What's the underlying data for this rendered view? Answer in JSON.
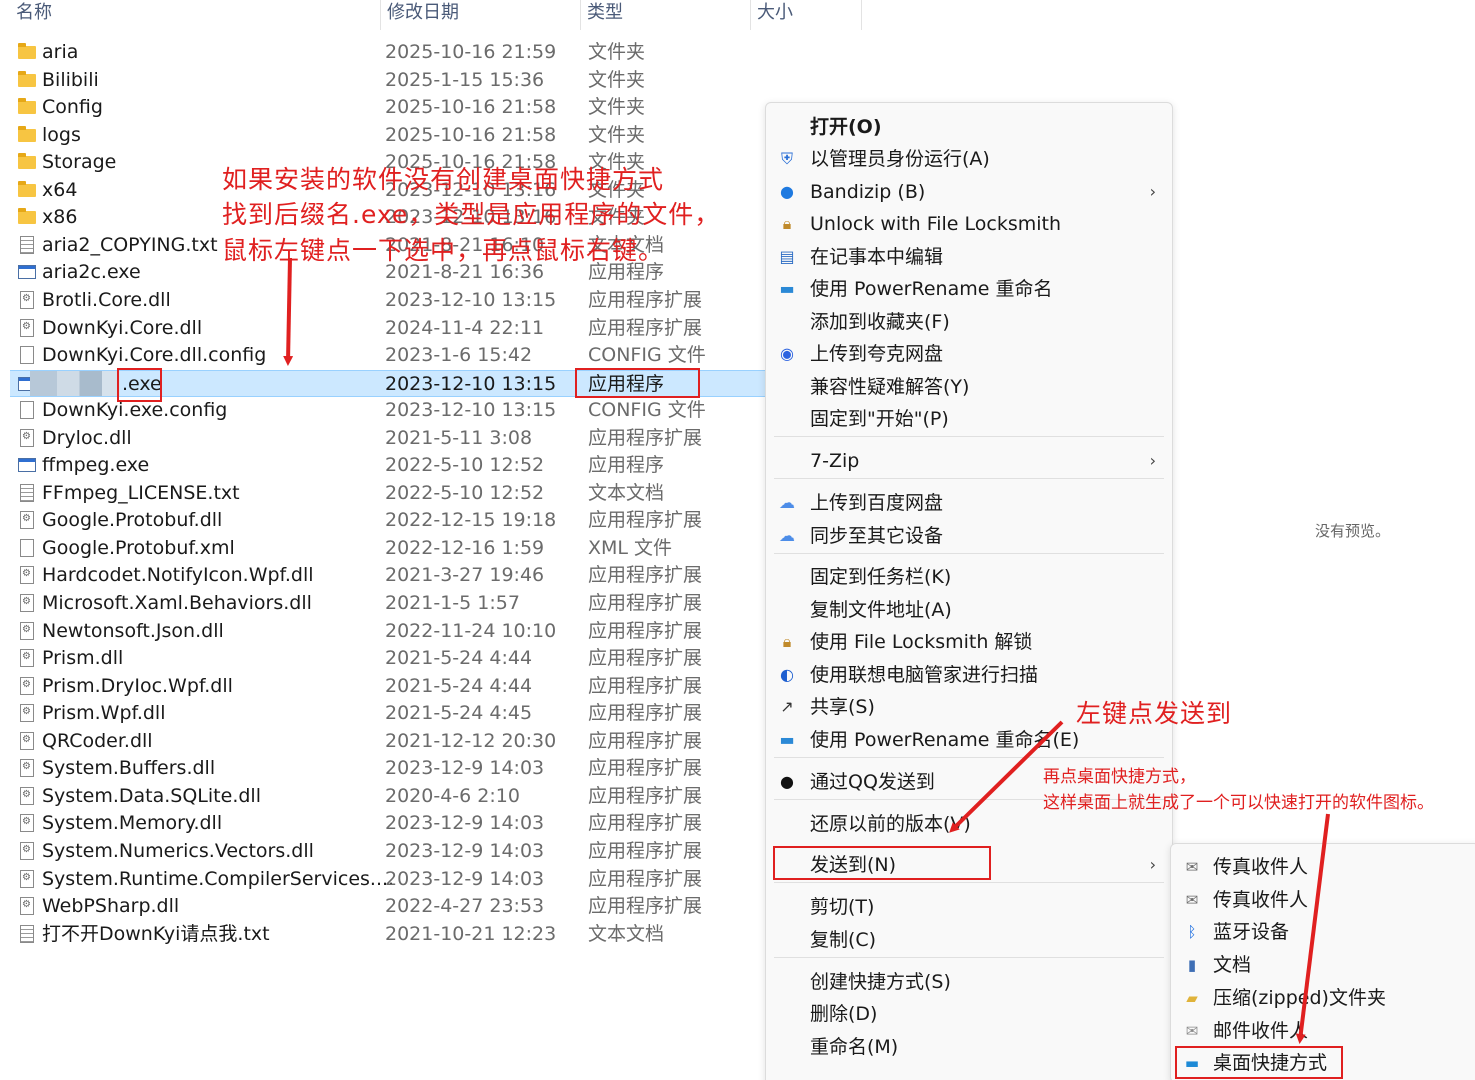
{
  "columns": {
    "name": "名称",
    "modified": "修改日期",
    "type": "类型",
    "size": "大小"
  },
  "files": [
    {
      "name": "aria",
      "date": "2025-10-16 21:59",
      "type": "文件夹",
      "icon": "folder"
    },
    {
      "name": "Bilibili",
      "date": "2025-1-15 15:36",
      "type": "文件夹",
      "icon": "folder"
    },
    {
      "name": "Config",
      "date": "2025-10-16 21:58",
      "type": "文件夹",
      "icon": "folder"
    },
    {
      "name": "logs",
      "date": "2025-10-16 21:58",
      "type": "文件夹",
      "icon": "folder"
    },
    {
      "name": "Storage",
      "date": "2025-10-16 21:58",
      "type": "文件夹",
      "icon": "folder"
    },
    {
      "name": "x64",
      "date": "2023-12-10 13:16",
      "type": "文件夹",
      "icon": "folder"
    },
    {
      "name": "x86",
      "date": "2023-12-10 13:16",
      "type": "文件夹",
      "icon": "folder"
    },
    {
      "name": "aria2_COPYING.txt",
      "date": "2021-8-21 16:10",
      "type": "文本文档",
      "icon": "txt"
    },
    {
      "name": "aria2c.exe",
      "date": "2021-8-21 16:36",
      "type": "应用程序",
      "icon": "exe"
    },
    {
      "name": "Brotli.Core.dll",
      "date": "2023-12-10 13:15",
      "type": "应用程序扩展",
      "icon": "dll"
    },
    {
      "name": "DownKyi.Core.dll",
      "date": "2024-11-4 22:11",
      "type": "应用程序扩展",
      "icon": "dll"
    },
    {
      "name": "DownKyi.Core.dll.config",
      "date": "2023-1-6 15:42",
      "type": "CONFIG 文件",
      "icon": "file"
    },
    {
      "name": ".exe",
      "date": "2023-12-10 13:15",
      "type": "应用程序",
      "icon": "exe",
      "selected": true
    },
    {
      "name": "DownKyi.exe.config",
      "date": "2023-12-10 13:15",
      "type": "CONFIG 文件",
      "icon": "file"
    },
    {
      "name": "Dryloc.dll",
      "date": "2021-5-11 3:08",
      "type": "应用程序扩展",
      "icon": "dll"
    },
    {
      "name": "ffmpeg.exe",
      "date": "2022-5-10 12:52",
      "type": "应用程序",
      "icon": "exe"
    },
    {
      "name": "FFmpeg_LICENSE.txt",
      "date": "2022-5-10 12:52",
      "type": "文本文档",
      "icon": "txt"
    },
    {
      "name": "Google.Protobuf.dll",
      "date": "2022-12-15 19:18",
      "type": "应用程序扩展",
      "icon": "dll"
    },
    {
      "name": "Google.Protobuf.xml",
      "date": "2022-12-16 1:59",
      "type": "XML 文件",
      "icon": "file"
    },
    {
      "name": "Hardcodet.NotifyIcon.Wpf.dll",
      "date": "2021-3-27 19:46",
      "type": "应用程序扩展",
      "icon": "dll"
    },
    {
      "name": "Microsoft.Xaml.Behaviors.dll",
      "date": "2021-1-5 1:57",
      "type": "应用程序扩展",
      "icon": "dll"
    },
    {
      "name": "Newtonsoft.Json.dll",
      "date": "2022-11-24 10:10",
      "type": "应用程序扩展",
      "icon": "dll"
    },
    {
      "name": "Prism.dll",
      "date": "2021-5-24 4:44",
      "type": "应用程序扩展",
      "icon": "dll"
    },
    {
      "name": "Prism.DryIoc.Wpf.dll",
      "date": "2021-5-24 4:44",
      "type": "应用程序扩展",
      "icon": "dll"
    },
    {
      "name": "Prism.Wpf.dll",
      "date": "2021-5-24 4:45",
      "type": "应用程序扩展",
      "icon": "dll"
    },
    {
      "name": "QRCoder.dll",
      "date": "2021-12-12 20:30",
      "type": "应用程序扩展",
      "icon": "dll"
    },
    {
      "name": "System.Buffers.dll",
      "date": "2023-12-9 14:03",
      "type": "应用程序扩展",
      "icon": "dll"
    },
    {
      "name": "System.Data.SQLite.dll",
      "date": "2020-4-6 2:10",
      "type": "应用程序扩展",
      "icon": "dll"
    },
    {
      "name": "System.Memory.dll",
      "date": "2023-12-9 14:03",
      "type": "应用程序扩展",
      "icon": "dll"
    },
    {
      "name": "System.Numerics.Vectors.dll",
      "date": "2023-12-9 14:03",
      "type": "应用程序扩展",
      "icon": "dll"
    },
    {
      "name": "System.Runtime.CompilerServices....",
      "date": "2023-12-9 14:03",
      "type": "应用程序扩展",
      "icon": "dll"
    },
    {
      "name": "WebPSharp.dll",
      "date": "2022-4-27 23:53",
      "type": "应用程序扩展",
      "icon": "dll"
    },
    {
      "name": "打不开DownKyi请点我.txt",
      "date": "2021-10-21 12:23",
      "type": "文本文档",
      "icon": "txt"
    }
  ],
  "context_menu": [
    {
      "label": "打开(O)",
      "icon": "none",
      "bold": true
    },
    {
      "label": "以管理员身份运行(A)",
      "icon": "shield-icon"
    },
    {
      "label": "Bandizip (B)",
      "icon": "bandizip-icon",
      "submenu": true
    },
    {
      "label": "Unlock with File Locksmith",
      "icon": "lock-icon"
    },
    {
      "label": "在记事本中编辑",
      "icon": "notepad-icon"
    },
    {
      "label": "使用 PowerRename 重命名",
      "icon": "rename-icon"
    },
    {
      "label": "添加到收藏夹(F)",
      "icon": "none"
    },
    {
      "label": "上传到夸克网盘",
      "icon": "quark-icon"
    },
    {
      "label": "兼容性疑难解答(Y)",
      "icon": "none"
    },
    {
      "label": "固定到\"开始\"(P)",
      "icon": "none"
    },
    {
      "label": "7-Zip",
      "icon": "none",
      "submenu": true
    },
    {
      "label": "上传到百度网盘",
      "icon": "baidu-icon"
    },
    {
      "label": "同步至其它设备",
      "icon": "baidu-icon"
    },
    {
      "label": "固定到任务栏(K)",
      "icon": "none"
    },
    {
      "label": "复制文件地址(A)",
      "icon": "none"
    },
    {
      "label": "使用 File Locksmith 解锁",
      "icon": "lock-icon"
    },
    {
      "label": "使用联想电脑管家进行扫描",
      "icon": "lenovo-icon"
    },
    {
      "label": "共享(S)",
      "icon": "share-icon"
    },
    {
      "label": "使用 PowerRename 重命名(E)",
      "icon": "rename-icon"
    },
    {
      "label": "通过QQ发送到",
      "icon": "qq-icon"
    },
    {
      "label": "还原以前的版本(V)",
      "icon": "none"
    },
    {
      "label": "发送到(N)",
      "icon": "none",
      "submenu": true
    },
    {
      "label": "剪切(T)",
      "icon": "none"
    },
    {
      "label": "复制(C)",
      "icon": "none"
    },
    {
      "label": "创建快捷方式(S)",
      "icon": "none"
    },
    {
      "label": "删除(D)",
      "icon": "none"
    },
    {
      "label": "重命名(M)",
      "icon": "none"
    }
  ],
  "send_to_menu": [
    {
      "label": "传真收件人",
      "icon": "fax-icon"
    },
    {
      "label": "传真收件人",
      "icon": "fax-icon"
    },
    {
      "label": "蓝牙设备",
      "icon": "bluetooth-icon"
    },
    {
      "label": "文档",
      "icon": "document-icon"
    },
    {
      "label": "压缩(zipped)文件夹",
      "icon": "zip-folder-icon"
    },
    {
      "label": "邮件收件人",
      "icon": "mail-icon"
    },
    {
      "label": "桌面快捷方式",
      "icon": "desktop-icon"
    }
  ],
  "preview_text": "没有预览。",
  "annotations": {
    "step1_line1": "如果安装的软件没有创建桌面快捷方式",
    "step1_line2": "找到后缀名.exe，类型是应用程序的文件，",
    "step1_line3": "鼠标左键点一下选中，再点鼠标右键。",
    "step2": "左键点发送到",
    "step3_line1": "再点桌面快捷方式，",
    "step3_line2": "这样桌面上就生成了一个可以快速打开的软件图标。"
  },
  "colors": {
    "annotation_red": "#e02020",
    "selection_blue": "#cce8ff"
  }
}
